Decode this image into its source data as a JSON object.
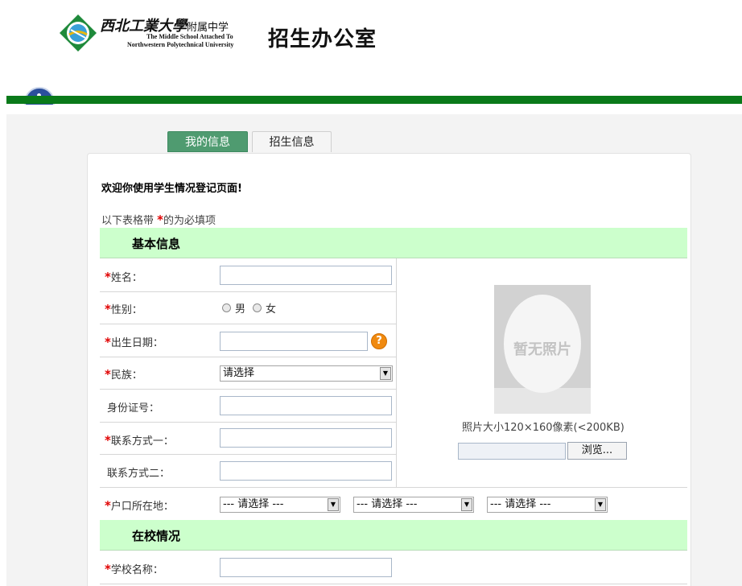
{
  "header": {
    "logo_cn": "西北工業大學",
    "logo_cn_suffix": "附属中学",
    "logo_en_line1": "The Middle School Attached To",
    "logo_en_line2": "Northwestern Polytechnical University",
    "office_title": "招生办公室"
  },
  "colors": {
    "brand_green": "#0a7a1a",
    "tab_active": "#4f9b70",
    "section_bg": "#ccffcc",
    "required": "#e00000"
  },
  "tabs": [
    {
      "label": "我的信息",
      "active": true
    },
    {
      "label": "招生信息",
      "active": false
    }
  ],
  "welcome": "欢迎你使用学生情况登记页面!",
  "required_note": {
    "before": "以下表格带 ",
    "star": "*",
    "after": "的为必填项"
  },
  "sections": {
    "basic": "基本信息",
    "school": "在校情况"
  },
  "fields": {
    "name": {
      "label": "姓名：",
      "required": true,
      "value": ""
    },
    "gender": {
      "label": "性别：",
      "required": true,
      "options": [
        "男",
        "女"
      ]
    },
    "birth": {
      "label": "出生日期：",
      "required": true,
      "value": "",
      "help_icon": "question-icon",
      "help_glyph": "?"
    },
    "ethnicity": {
      "label": "民族：",
      "required": true,
      "selected": "请选择"
    },
    "id_number": {
      "label": "身份证号：",
      "required": false,
      "value": ""
    },
    "contact1": {
      "label": "联系方式一：",
      "required": true,
      "value": ""
    },
    "contact2": {
      "label": "联系方式二：",
      "required": false,
      "value": ""
    },
    "hukou": {
      "label": "户口所在地：",
      "required": true,
      "selects": [
        "--- 请选择 ---",
        "--- 请选择 ---",
        "--- 请选择 ---"
      ]
    },
    "school_name": {
      "label": "学校名称：",
      "required": true,
      "value": ""
    }
  },
  "photo": {
    "placeholder_text": "暂无照片",
    "size_note": "照片大小120×160像素(<200KB)",
    "browse_label": "浏览..."
  },
  "star": "*"
}
